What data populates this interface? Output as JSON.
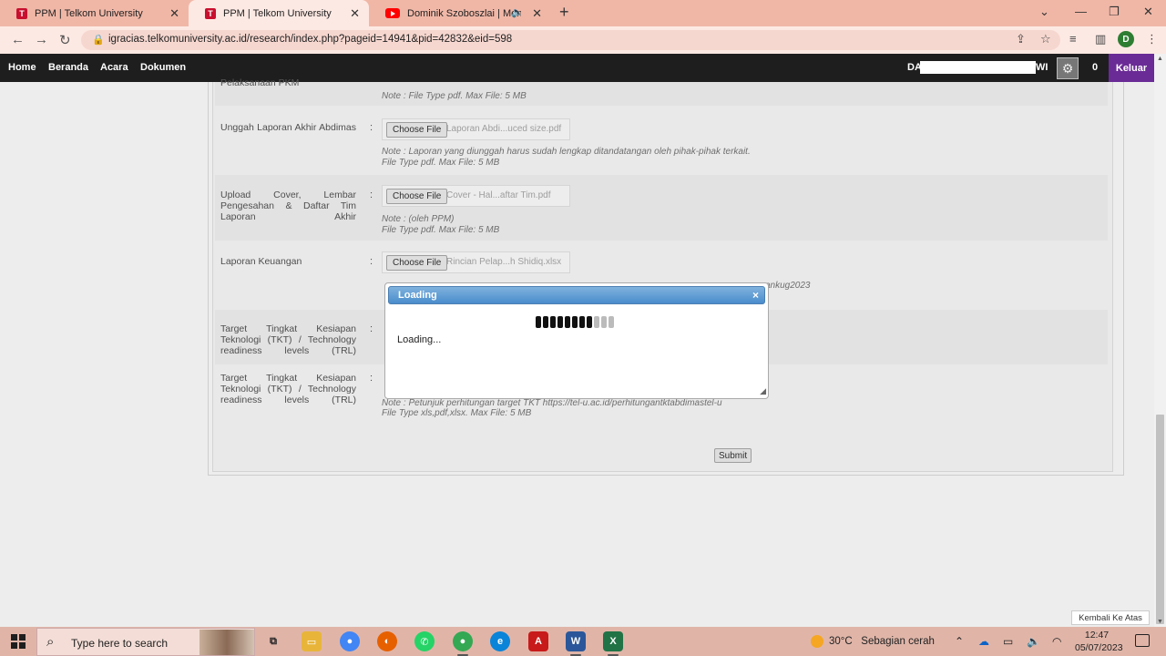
{
  "browser": {
    "tabs": [
      {
        "title": "PPM | Telkom University",
        "icon": "telkom-favicon"
      },
      {
        "title": "PPM | Telkom University",
        "icon": "telkom-favicon"
      },
      {
        "title": "Dominik Szoboszlai | Menga",
        "icon": "youtube-favicon"
      }
    ],
    "url": "igracias.telkomuniversity.ac.id/research/index.php?pageid=14941&pid=42832&eid=598",
    "profile_initial": "D"
  },
  "site": {
    "menu": [
      "Home",
      "Beranda",
      "Acara",
      "Dokumen"
    ],
    "user_prefix": "DA",
    "user_suffix": "WI",
    "notification_count": "0",
    "logout_label": "Keluar"
  },
  "form": {
    "top_label_fragment": "Pelaksanaan PKM",
    "top_note": "Note : File Type pdf. Max File: 5 MB",
    "rows": [
      {
        "label": "Unggah Laporan Akhir Abdimas",
        "button": "Choose File",
        "filename": "Laporan Abdi...uced size.pdf",
        "note1": "Note : Laporan yang diunggah harus sudah lengkap ditandatangan oleh pihak-pihak terkait.",
        "note2": "File Type pdf. Max File: 5 MB"
      },
      {
        "label": "Upload Cover, Lembar Pengesahan & Daftar Tim Laporan Akhir",
        "button": "Choose File",
        "filename": "Cover - Hal...aftar Tim.pdf",
        "note1": "Note : (oleh PPM)",
        "note2": "File Type pdf. Max File: 5 MB"
      },
      {
        "label": "Laporan Keuangan",
        "button": "Choose File",
        "filename": "Rincian Pelap...h Shidiq.xlsx",
        "note_fragment": "ankug2023"
      },
      {
        "label": "Target Tingkat Kesiapan Teknologi (TKT) / Technology readiness levels (TRL)"
      },
      {
        "label": "Target Tingkat Kesiapan Teknologi (TKT) / Technology readiness levels (TRL)",
        "note1": "Note : Petunjuk perhitungan target TKT https://tel-u.ac.id/perhitungantktabdimastel-u",
        "note2": "File Type xls,pdf,xlsx. Max File: 5 MB"
      }
    ],
    "submit_label": "Submit"
  },
  "dialog": {
    "title": "Loading",
    "close": "×",
    "message": "Loading...",
    "progress_segments": 11,
    "progress_filled": 8
  },
  "back_to_top": "Kembali Ke Atas",
  "taskbar": {
    "search_placeholder": "Type here to search",
    "weather_temp": "30°C",
    "weather_desc": "Sebagian cerah",
    "time": "12:47",
    "date": "05/07/2023"
  }
}
